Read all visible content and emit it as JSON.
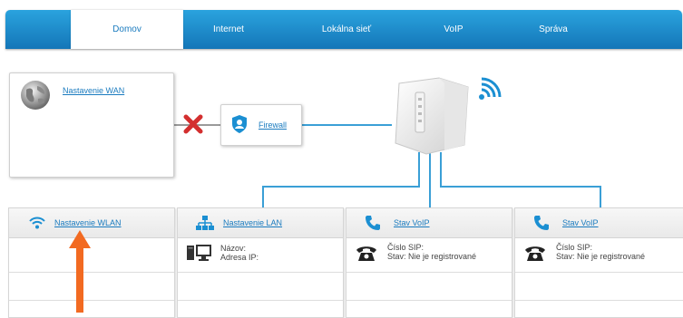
{
  "nav": {
    "tabs": [
      {
        "label": "Domov",
        "active": true
      },
      {
        "label": "Internet",
        "active": false
      },
      {
        "label": "Lokálna sieť",
        "active": false
      },
      {
        "label": "VoIP",
        "active": false
      },
      {
        "label": "Správa",
        "active": false
      }
    ]
  },
  "wan": {
    "link": "Nastavenie WAN",
    "icon": "globe-icon"
  },
  "firewall": {
    "link": "Firewall",
    "icon": "shield-icon",
    "blocked_icon": "red-x-icon"
  },
  "router": {
    "icon": "router-icon",
    "wifi_icon": "wifi-signal-icon"
  },
  "panels": [
    {
      "link": "Nastavenie WLAN",
      "icon": "wifi-icon",
      "lines": []
    },
    {
      "link": "Nastavenie LAN",
      "icon": "network-icon",
      "lines": [
        "Názov:",
        "Adresa IP:"
      ],
      "device_icon": "computer-icon"
    },
    {
      "link": "Stav VoIP",
      "icon": "phone-icon",
      "lines": [
        "Číslo SIP:",
        "Stav: Nie je registrované"
      ],
      "device_icon": "telephone-icon"
    },
    {
      "link": "Stav VoIP",
      "icon": "phone-icon",
      "lines": [
        "Číslo SIP:",
        "Stav: Nie je registrované"
      ],
      "device_icon": "telephone-icon"
    }
  ],
  "colors": {
    "nav": "#1a8fd0",
    "link": "#1a7bbf",
    "connector": "#3a9fd6",
    "arrow": "#f26a21",
    "block": "#d32f2f"
  }
}
